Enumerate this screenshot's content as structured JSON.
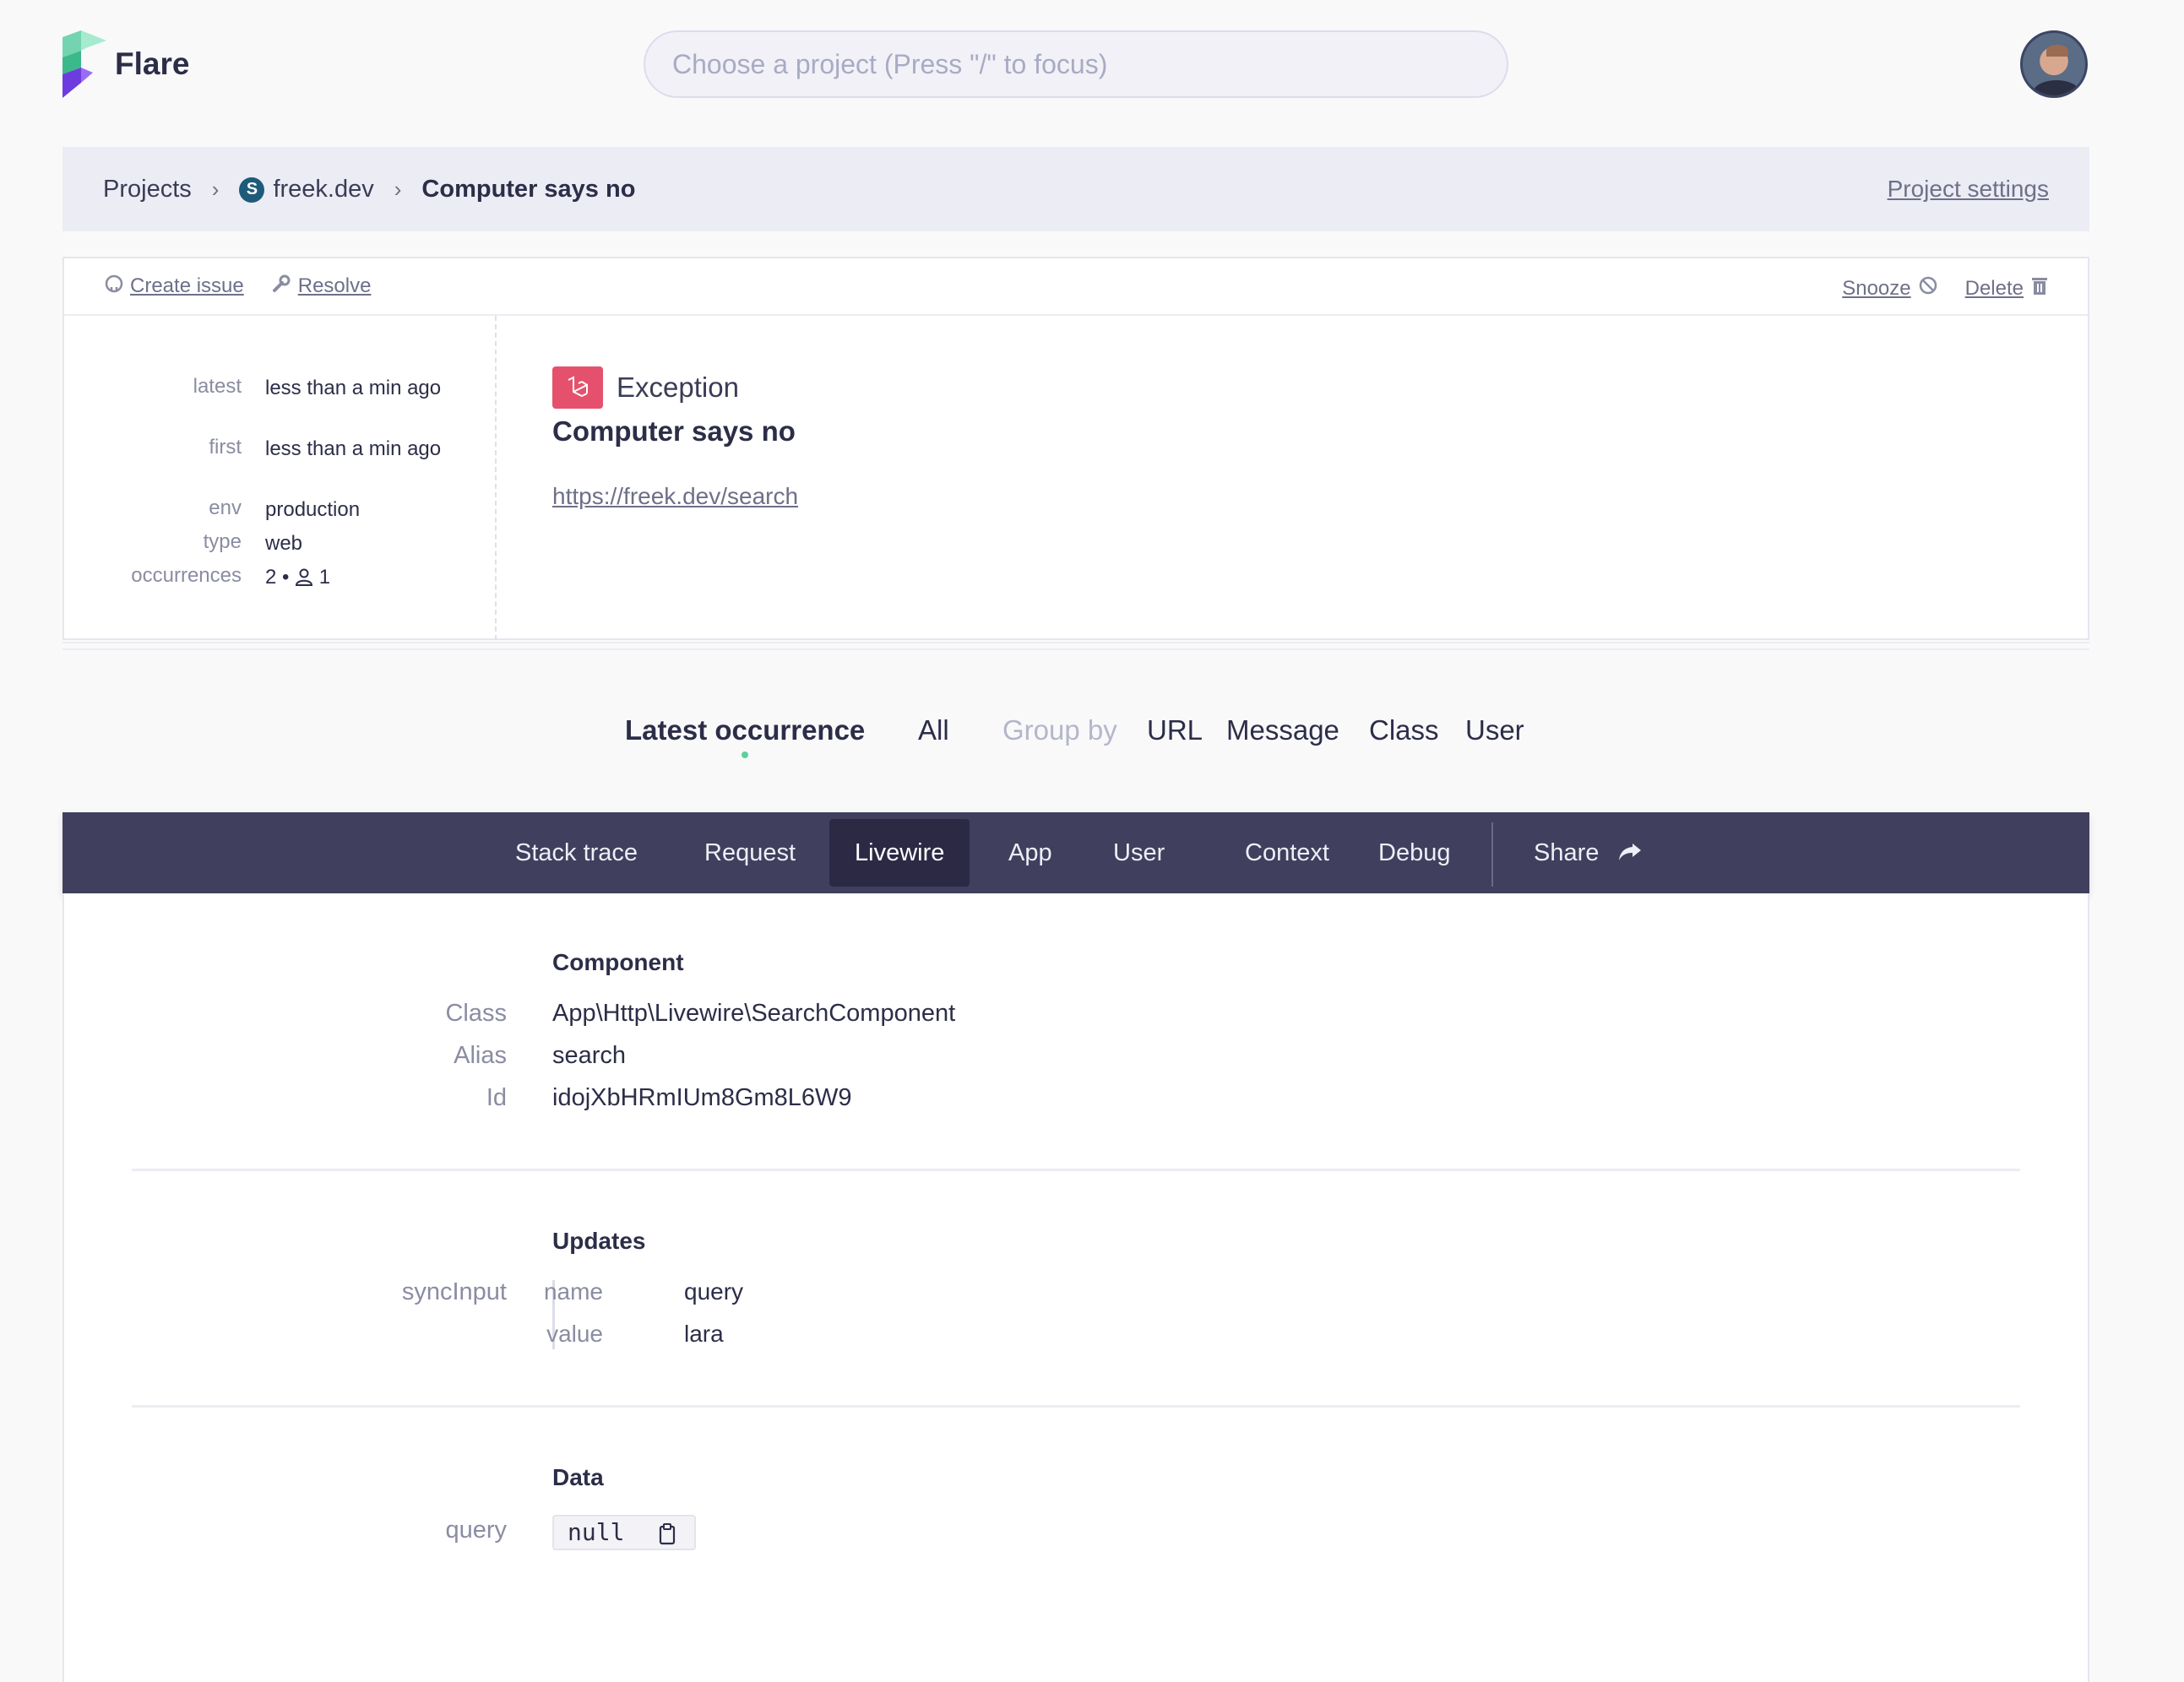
{
  "header": {
    "app_name": "Flare",
    "search_placeholder": "Choose a project (Press \"/\" to focus)"
  },
  "breadcrumb": {
    "items": [
      "Projects",
      "freek.dev",
      "Computer says no"
    ],
    "site_badge": "S",
    "project_settings": "Project settings"
  },
  "toolbar": {
    "create_issue": "Create issue",
    "resolve": "Resolve",
    "snooze": "Snooze",
    "delete": "Delete"
  },
  "meta": {
    "latest_key": "latest",
    "latest_val": "less than a min ago",
    "first_key": "first",
    "first_val": "less than a min ago",
    "env_key": "env",
    "env_val": "production",
    "type_key": "type",
    "type_val": "web",
    "occurrences_key": "occurrences",
    "occurrences_count": "2",
    "occurrences_users": "1"
  },
  "exception": {
    "type": "Exception",
    "message": "Computer says no",
    "url": "https://freek.dev/search"
  },
  "occurrence_tabs": {
    "latest": "Latest occurrence",
    "all": "All",
    "group_by": "Group by",
    "url": "URL",
    "message": "Message",
    "class": "Class",
    "user": "User"
  },
  "tabs": [
    "Stack trace",
    "Request",
    "Livewire",
    "App",
    "User",
    "Context",
    "Debug",
    "Share"
  ],
  "active_tab": "Livewire",
  "livewire": {
    "component": {
      "title": "Component",
      "class_key": "Class",
      "class_val": "App\\Http\\Livewire\\SearchComponent",
      "alias_key": "Alias",
      "alias_val": "search",
      "id_key": "Id",
      "id_val": "idojXbHRmIUm8Gm8L6W9"
    },
    "updates": {
      "title": "Updates",
      "type": "syncInput",
      "name_key": "name",
      "name_val": "query",
      "value_key": "value",
      "value_val": "lara"
    },
    "data": {
      "title": "Data",
      "query_key": "query",
      "query_val": "null"
    }
  },
  "colors": {
    "tab_bar": "#403f5e",
    "active_tab": "#2b2944",
    "exception_badge": "#e5516c",
    "accent_dot": "#5cd19a"
  }
}
